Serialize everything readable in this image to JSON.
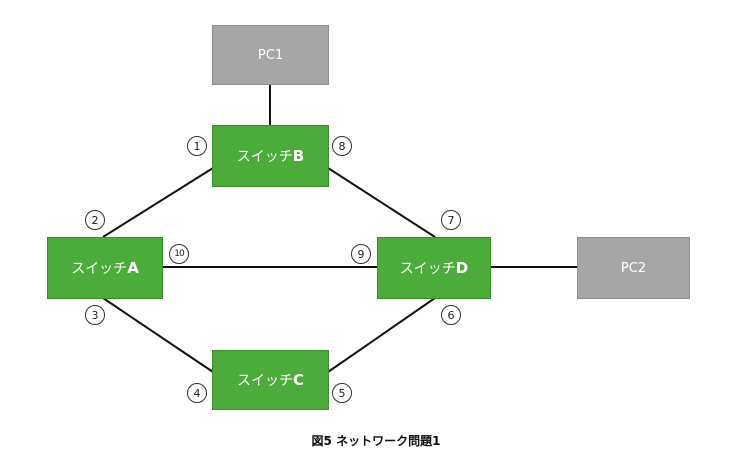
{
  "diagram": {
    "pcs": {
      "pc1": "PC1",
      "pc2": "PC2"
    },
    "switches": {
      "a": {
        "prefix": "スイッチ",
        "letter": "A"
      },
      "b": {
        "prefix": "スイッチ",
        "letter": "B"
      },
      "c": {
        "prefix": "スイッチ",
        "letter": "C"
      },
      "d": {
        "prefix": "スイッチ",
        "letter": "D"
      }
    },
    "ports": [
      "1",
      "2",
      "3",
      "4",
      "5",
      "6",
      "7",
      "8",
      "9",
      "10"
    ],
    "caption": "図5 ネットワーク問題1",
    "colors": {
      "switch": "#4cac3b",
      "pc": "#a6a6a6",
      "line": "#111111"
    }
  }
}
